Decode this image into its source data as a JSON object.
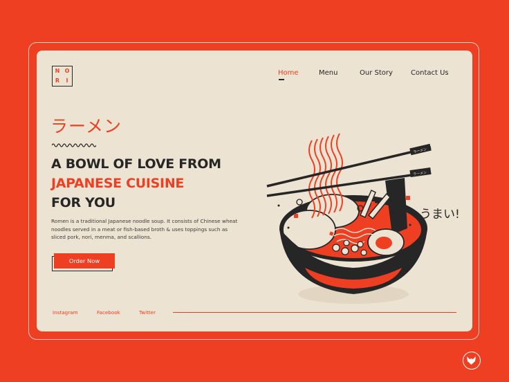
{
  "brand": {
    "logo_letters": [
      "N",
      "O",
      "R",
      "I"
    ]
  },
  "nav": {
    "items": [
      {
        "label": "Home",
        "active": true
      },
      {
        "label": "Menu",
        "active": false
      },
      {
        "label": "Our Story",
        "active": false
      },
      {
        "label": "Contact Us",
        "active": false
      }
    ]
  },
  "hero": {
    "jp_title": "ラーメン",
    "headline_line1": "A BOWL OF LOVE FROM",
    "headline_line2": "JAPANESE CUISINE",
    "headline_line3": "FOR YOU",
    "description": "Romen is a traditional Japanese noodle soup. It consists of Chinese wheat noodles served in a meat or fish-based broth & uses toppings such as sliced pork, nori, menma, and scallions.",
    "cta_label": "Order Now"
  },
  "illustration": {
    "exclamation": "うまい!",
    "chopstick_label": "ラーメン"
  },
  "footer": {
    "social": [
      "Instagram",
      "Facebook",
      "Twitter"
    ]
  },
  "colors": {
    "accent": "#EE3F22",
    "card_bg": "#EDE3D2",
    "ink": "#262626"
  }
}
